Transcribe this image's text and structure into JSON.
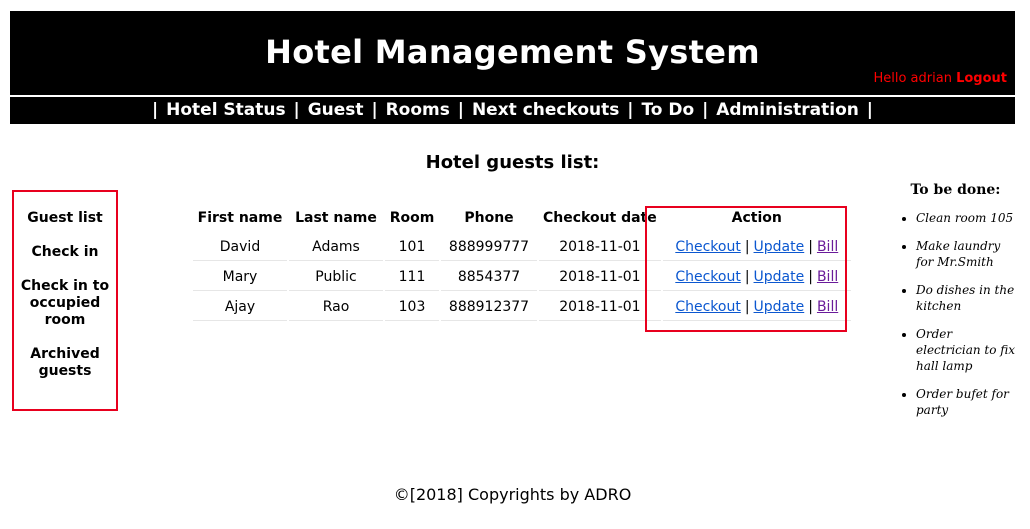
{
  "header": {
    "title": "Hotel Management System",
    "greeting": "Hello adrian",
    "logout_label": "Logout"
  },
  "nav": {
    "items": [
      "Hotel Status",
      "Guest",
      "Rooms",
      "Next checkouts",
      "To Do",
      "Administration"
    ],
    "separator": "|"
  },
  "sidebar": {
    "items": [
      "Guest list",
      "Check in",
      "Check in to occupied room",
      "Archived guests"
    ]
  },
  "main": {
    "heading": "Hotel guests list:",
    "columns": [
      "First name",
      "Last name",
      "Room",
      "Phone",
      "Checkout date",
      "Action"
    ],
    "rows": [
      {
        "first": "David",
        "last": "Adams",
        "room": "101",
        "phone": "888999777",
        "checkout": "2018-11-01"
      },
      {
        "first": "Mary",
        "last": "Public",
        "room": "111",
        "phone": "8854377",
        "checkout": "2018-11-01"
      },
      {
        "first": "Ajay",
        "last": "Rao",
        "room": "103",
        "phone": "888912377",
        "checkout": "2018-11-01"
      }
    ],
    "actions": {
      "checkout": "Checkout",
      "update": "Update",
      "bill": "Bill",
      "separator": "|"
    }
  },
  "todo": {
    "title": "To be done:",
    "items": [
      "Clean room 105",
      "Make laundry for Mr.Smith",
      "Do dishes in the kitchen",
      "Order electrician to fix hall lamp",
      "Order bufet for party"
    ]
  },
  "footer": {
    "text": "©[2018] Copyrights by ADRO"
  },
  "colors": {
    "header_bg": "#000000",
    "header_text": "#ffffff",
    "greeting": "#ff0000",
    "highlight_border": "#e8001e",
    "link": "#0b57d0",
    "visited_link": "#6a1b9a"
  }
}
